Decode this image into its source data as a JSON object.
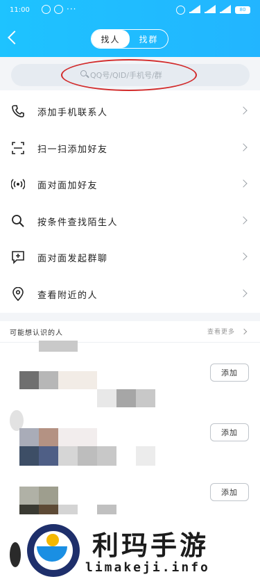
{
  "status": {
    "time": "11:00",
    "dots": "···",
    "battery": "80"
  },
  "tabs": [
    {
      "label": "找人"
    },
    {
      "label": "找群"
    }
  ],
  "search": {
    "placeholder": "QQ号/QID/手机号/群"
  },
  "menu": [
    {
      "label": "添加手机联系人",
      "icon": "phone-icon"
    },
    {
      "label": "扫一扫添加好友",
      "icon": "scan-icon"
    },
    {
      "label": "面对面加好友",
      "icon": "broadcast-icon"
    },
    {
      "label": "按条件查找陌生人",
      "icon": "search-icon"
    },
    {
      "label": "面对面发起群聊",
      "icon": "chat-add-icon"
    },
    {
      "label": "查看附近的人",
      "icon": "location-pin-icon"
    }
  ],
  "suggestions": {
    "title": "可能想认识的人",
    "more": "查看更多",
    "add_label": "添加"
  },
  "watermark": {
    "name": "利玛手游",
    "url": "limakeji.info"
  },
  "colors": {
    "header": "#22b5ff",
    "annotation_ring": "#d22b2b"
  }
}
